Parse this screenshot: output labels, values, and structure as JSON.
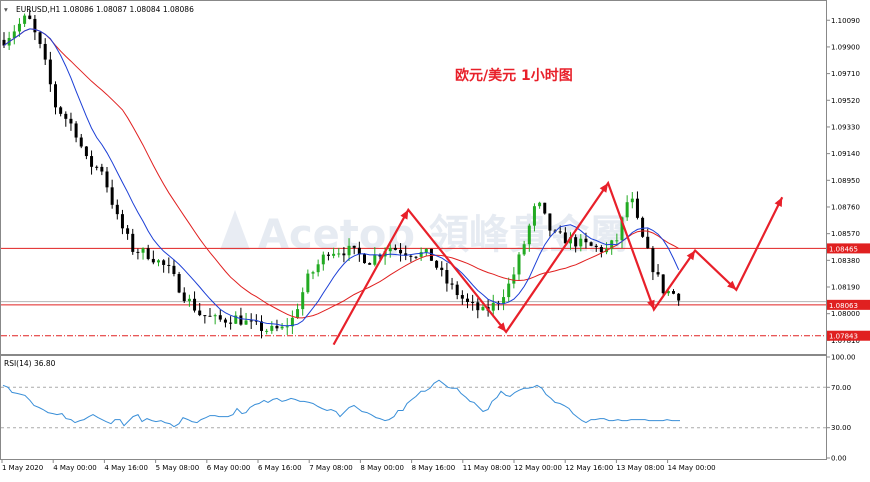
{
  "window": {
    "title": "EURUSD,H1  1.08086 1.08087 1.08084 1.08086",
    "rsi_label": "RSI(14) 36.80",
    "annotation": "欧元/美元  1小时图",
    "watermark": "Acetop 領峰貴金屬"
  },
  "colors": {
    "bull": "#22aa22",
    "bear": "#000000",
    "ma_fast": "#1c3fd6",
    "ma_slow": "#e02020",
    "levels": "#e02020",
    "projection": "#e8202a",
    "rsi": "#3a8fd8",
    "grid_axis": "#999999"
  },
  "chart_data": [
    {
      "type": "candlestick",
      "title": "欧元/美元  1小时图",
      "symbol": "EURUSD",
      "timeframe": "H1",
      "ylim": [
        1.0772,
        1.1022
      ],
      "y_ticks": [
        1.1009,
        1.099,
        1.0971,
        1.0952,
        1.0933,
        1.0914,
        1.0895,
        1.0876,
        1.0857,
        1.0838,
        1.0819,
        1.08,
        1.0781
      ],
      "y_tick_labels": [
        "1.10090",
        "1.09900",
        "1.09710",
        "1.09520",
        "1.09330",
        "1.09140",
        "1.08950",
        "1.08760",
        "1.08570",
        "1.08380",
        "1.08190",
        "1.08000",
        "1.07810"
      ],
      "x_labels": [
        "1 May 2020",
        "4 May 00:00",
        "4 May 16:00",
        "5 May 08:00",
        "6 May 00:00",
        "6 May 16:00",
        "7 May 08:00",
        "8 May 00:00",
        "8 May 16:00",
        "11 May 08:00",
        "12 May 00:00",
        "12 May 16:00",
        "13 May 08:00",
        "14 May 00:00"
      ],
      "price_levels": [
        {
          "value": 1.08465,
          "label": "1.08465",
          "style": "solid"
        },
        {
          "value": 1.08063,
          "label": "1.08063",
          "style": "solid"
        },
        {
          "value": 1.07843,
          "label": "1.07843",
          "style": "dash-dot"
        }
      ],
      "last_price": 1.08086,
      "swing_points": [
        {
          "x": 0.0,
          "y": 1.0995
        },
        {
          "x": 4.6,
          "y": 1.1012
        },
        {
          "x": 7.5,
          "y": 1.0985
        },
        {
          "x": 10.0,
          "y": 1.0948
        },
        {
          "x": 13.7,
          "y": 1.0932
        },
        {
          "x": 16.2,
          "y": 1.0907
        },
        {
          "x": 19.0,
          "y": 1.0903
        },
        {
          "x": 22.0,
          "y": 1.0868
        },
        {
          "x": 25.0,
          "y": 1.0846
        },
        {
          "x": 28.3,
          "y": 1.0842
        },
        {
          "x": 32.0,
          "y": 1.0831
        },
        {
          "x": 35.0,
          "y": 1.0813
        },
        {
          "x": 38.0,
          "y": 1.08
        },
        {
          "x": 41.5,
          "y": 1.0795
        },
        {
          "x": 45.0,
          "y": 1.0797
        },
        {
          "x": 48.0,
          "y": 1.0792
        },
        {
          "x": 51.5,
          "y": 1.0788
        },
        {
          "x": 54.0,
          "y": 1.0789
        },
        {
          "x": 56.0,
          "y": 1.0796
        },
        {
          "x": 59.0,
          "y": 1.0825
        },
        {
          "x": 63.0,
          "y": 1.0845
        },
        {
          "x": 67.0,
          "y": 1.0845
        },
        {
          "x": 71.0,
          "y": 1.0838
        },
        {
          "x": 74.5,
          "y": 1.0848
        },
        {
          "x": 78.0,
          "y": 1.0844
        },
        {
          "x": 82.5,
          "y": 1.0842
        },
        {
          "x": 86.0,
          "y": 1.0822
        },
        {
          "x": 90.0,
          "y": 1.0807
        },
        {
          "x": 93.0,
          "y": 1.0801
        },
        {
          "x": 95.5,
          "y": 1.0807
        },
        {
          "x": 98.5,
          "y": 1.0823
        },
        {
          "x": 101.0,
          "y": 1.085
        },
        {
          "x": 103.5,
          "y": 1.088
        },
        {
          "x": 106.5,
          "y": 1.0856
        },
        {
          "x": 110.0,
          "y": 1.0852
        },
        {
          "x": 114.5,
          "y": 1.0847
        },
        {
          "x": 117.0,
          "y": 1.0845
        },
        {
          "x": 119.0,
          "y": 1.0853
        },
        {
          "x": 121.5,
          "y": 1.0886
        },
        {
          "x": 123.5,
          "y": 1.0858
        },
        {
          "x": 126.0,
          "y": 1.0833
        },
        {
          "x": 128.0,
          "y": 1.0817
        },
        {
          "x": 131.0,
          "y": 1.0813
        }
      ],
      "projection": [
        {
          "x": 0.0,
          "y": 1.0778
        },
        {
          "x": 14.5,
          "y": 1.0874
        },
        {
          "x": 33.5,
          "y": 1.0787
        },
        {
          "x": 53.3,
          "y": 1.0893
        },
        {
          "x": 62.2,
          "y": 1.0803
        },
        {
          "x": 70.2,
          "y": 1.0845
        },
        {
          "x": 78.2,
          "y": 1.0817
        },
        {
          "x": 87.1,
          "y": 1.0883
        }
      ]
    },
    {
      "type": "line",
      "title": "RSI(14) 36.80",
      "ylim": [
        0,
        100
      ],
      "y_ticks": [
        100.0,
        70.0,
        30.0,
        0.0
      ],
      "y_tick_labels": [
        "100.00",
        "70.00",
        "30.00",
        "0.00"
      ],
      "levels": [
        70,
        30
      ],
      "current": 36.8,
      "x": [
        0,
        5,
        9,
        14,
        18,
        22,
        27,
        31,
        36,
        40,
        45,
        50,
        54,
        59,
        63,
        68,
        72,
        77,
        81,
        86,
        90,
        95,
        99,
        103,
        108,
        112,
        117,
        121,
        126,
        130,
        135,
        139,
        144,
        149,
        153,
        158,
        162,
        167,
        171,
        176,
        180,
        185,
        189,
        194,
        198,
        203,
        207,
        212,
        216,
        221,
        225,
        230,
        234,
        239,
        243,
        247,
        252,
        256,
        261,
        265,
        270,
        274,
        279,
        283,
        288,
        292,
        297,
        301,
        306,
        310,
        315,
        319,
        324,
        328,
        333,
        337,
        342,
        346,
        351,
        355,
        359,
        364,
        368,
        373,
        377,
        382,
        386,
        391,
        395,
        400,
        404,
        409,
        413,
        418,
        422,
        427,
        431,
        436,
        440,
        445,
        449,
        454,
        458,
        463,
        467,
        471,
        476,
        480,
        485,
        489,
        494,
        498,
        503,
        507,
        512,
        516,
        521,
        525,
        530,
        534,
        539,
        543,
        548,
        552,
        557,
        561,
        566,
        570,
        575,
        579,
        583,
        588,
        592,
        597,
        601,
        606,
        610,
        615,
        619,
        624,
        628,
        633,
        637,
        642,
        646,
        651,
        655,
        660,
        664,
        669,
        673,
        677
      ],
      "values": [
        72,
        70,
        65,
        64,
        63,
        62,
        57,
        52,
        50,
        48,
        45,
        44,
        43,
        44,
        39,
        38,
        35,
        37,
        38,
        41,
        43,
        40,
        38,
        36,
        34,
        38,
        38,
        32,
        37,
        41,
        43,
        36,
        39,
        37,
        36,
        37,
        35,
        34,
        31,
        34,
        40,
        38,
        36,
        35,
        38,
        40,
        42,
        42,
        41,
        41,
        41,
        43,
        49,
        44,
        45,
        50,
        53,
        54,
        57,
        55,
        58,
        59,
        56,
        57,
        59,
        58,
        56,
        56,
        55,
        54,
        51,
        49,
        47,
        48,
        46,
        41,
        46,
        50,
        52,
        49,
        46,
        45,
        43,
        40,
        39,
        37,
        38,
        41,
        47,
        47,
        54,
        58,
        61,
        66,
        66,
        69,
        74,
        77,
        74,
        70,
        69,
        69,
        64,
        60,
        56,
        55,
        50,
        46,
        48,
        56,
        60,
        66,
        62,
        61,
        65,
        67,
        69,
        69,
        70,
        72,
        69,
        63,
        59,
        55,
        54,
        52,
        49,
        44,
        40,
        37,
        35,
        38,
        38,
        39,
        39,
        37,
        37,
        38,
        37,
        37,
        38,
        38,
        38,
        38,
        37,
        37,
        37,
        37,
        38,
        37,
        37,
        37
      ]
    }
  ]
}
